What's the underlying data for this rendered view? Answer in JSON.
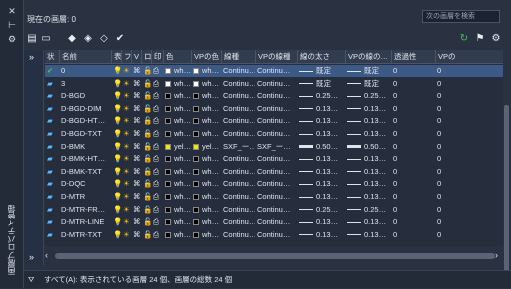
{
  "palette": {
    "selected_row": "#3d5a86",
    "bulb": "#f2c232",
    "lock": "#e8b23a",
    "green": "#44c060",
    "cyan": "#5ab6ff",
    "yellow": "#f2e600",
    "black": "#000000",
    "white": "#ffffff"
  },
  "side_title": "画層プロパティ管理",
  "current_layer_label": "現在の画層: 0",
  "search_placeholder": "次の画層を検索",
  "toolbar": {
    "icons": [
      "layer-states-icon",
      "folder-icon",
      "new-layer-icon",
      "new-vp-frozen-icon",
      "delete-layer-icon",
      "set-current-icon",
      "refresh-icon",
      "settings-icon",
      "gear-icon"
    ]
  },
  "left_expand": "»",
  "columns": [
    "状",
    "名前",
    "表",
    "フ",
    "V",
    "ロ",
    "印",
    "色",
    "VPの色",
    "線種",
    "VPの線種",
    "線の太さ",
    "VPの線の…",
    "透過性",
    "VPの"
  ],
  "rows": [
    {
      "name": "0",
      "color": "wh…",
      "vp_color": "wh…",
      "linetype": "Continu…",
      "vp_linetype": "Continu…",
      "lw": "既定",
      "vp_lw": "既定",
      "tr": "0",
      "vp_tr": "0",
      "current": true,
      "color_hex": "#ffffff"
    },
    {
      "name": "3",
      "color": "wh…",
      "vp_color": "wh…",
      "linetype": "Continu…",
      "vp_linetype": "Continu…",
      "lw": "既定",
      "vp_lw": "既定",
      "tr": "0",
      "vp_tr": "0",
      "color_hex": "#ffffff"
    },
    {
      "name": "D-BGD",
      "color": "wh…",
      "vp_color": "wh…",
      "linetype": "Continu…",
      "vp_linetype": "Continu…",
      "lw": "0.25…",
      "vp_lw": "0.25…",
      "tr": "0",
      "vp_tr": "0",
      "color_hex": "#000000"
    },
    {
      "name": "D-BGD-DIM",
      "color": "wh…",
      "vp_color": "wh…",
      "linetype": "Continu…",
      "vp_linetype": "Continu…",
      "lw": "0.13…",
      "vp_lw": "0.13…",
      "tr": "0",
      "vp_tr": "0",
      "color_hex": "#000000"
    },
    {
      "name": "D-BGD-HT…",
      "color": "wh…",
      "vp_color": "wh…",
      "linetype": "Continu…",
      "vp_linetype": "Continu…",
      "lw": "0.13…",
      "vp_lw": "0.13…",
      "tr": "0",
      "vp_tr": "0",
      "color_hex": "#000000"
    },
    {
      "name": "D-BGD-TXT",
      "color": "wh…",
      "vp_color": "wh…",
      "linetype": "Continu…",
      "vp_linetype": "Continu…",
      "lw": "0.13…",
      "vp_lw": "0.13…",
      "tr": "0",
      "vp_tr": "0",
      "color_hex": "#000000"
    },
    {
      "name": "D-BMK",
      "color": "yel…",
      "vp_color": "yel…",
      "linetype": "SXF_ー…",
      "vp_linetype": "SXF_ー…",
      "lw": "0.50…",
      "vp_lw": "0.50…",
      "tr": "0",
      "vp_tr": "0",
      "color_hex": "#f2e600",
      "thick": true
    },
    {
      "name": "D-BMK-HT…",
      "color": "wh…",
      "vp_color": "wh…",
      "linetype": "Continu…",
      "vp_linetype": "Continu…",
      "lw": "0.13…",
      "vp_lw": "0.13…",
      "tr": "0",
      "vp_tr": "0",
      "color_hex": "#000000"
    },
    {
      "name": "D-BMK-TXT",
      "color": "wh…",
      "vp_color": "wh…",
      "linetype": "Continu…",
      "vp_linetype": "Continu…",
      "lw": "0.13…",
      "vp_lw": "0.13…",
      "tr": "0",
      "vp_tr": "0",
      "color_hex": "#000000"
    },
    {
      "name": "D-DQC",
      "color": "wh…",
      "vp_color": "wh…",
      "linetype": "Continu…",
      "vp_linetype": "Continu…",
      "lw": "0.13…",
      "vp_lw": "0.13…",
      "tr": "0",
      "vp_tr": "0",
      "color_hex": "#000000"
    },
    {
      "name": "D-MTR",
      "color": "wh…",
      "vp_color": "wh…",
      "linetype": "Continu…",
      "vp_linetype": "Continu…",
      "lw": "0.13…",
      "vp_lw": "0.13…",
      "tr": "0",
      "vp_tr": "0",
      "color_hex": "#000000"
    },
    {
      "name": "D-MTR-FR…",
      "color": "wh…",
      "vp_color": "wh…",
      "linetype": "Continu…",
      "vp_linetype": "Continu…",
      "lw": "0.25…",
      "vp_lw": "0.25…",
      "tr": "0",
      "vp_tr": "0",
      "color_hex": "#000000"
    },
    {
      "name": "D-MTR-LINE",
      "color": "wh…",
      "vp_color": "wh…",
      "linetype": "Continu…",
      "vp_linetype": "Continu…",
      "lw": "0.13…",
      "vp_lw": "0.13…",
      "tr": "0",
      "vp_tr": "0",
      "color_hex": "#000000"
    },
    {
      "name": "D-MTR-TXT",
      "color": "wh…",
      "vp_color": "wh…",
      "linetype": "Continu…",
      "vp_linetype": "Continu…",
      "lw": "0.13…",
      "vp_lw": "0.13…",
      "tr": "0",
      "vp_tr": "0",
      "color_hex": "#000000"
    }
  ],
  "status_text": "すべて(A): 表示されている画層 24 個、画層の総数 24 個"
}
